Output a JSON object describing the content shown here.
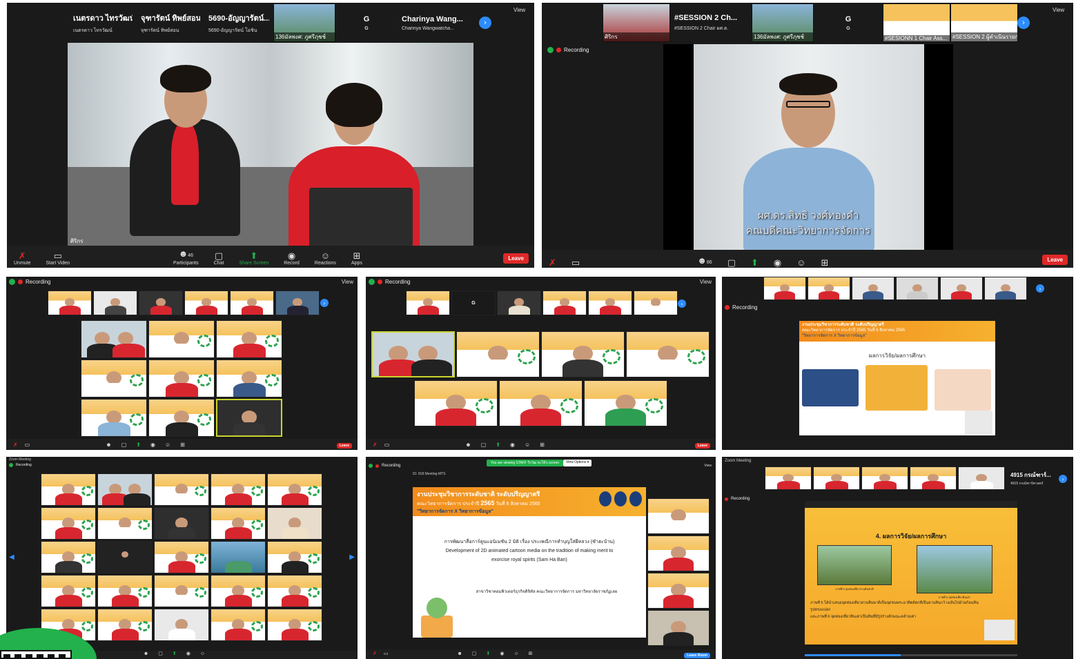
{
  "zoom": {
    "view_label": "View",
    "leave_label": "Leave",
    "recording_label": "Recording",
    "toolbar": {
      "unmute": "Unmute",
      "start_video": "Start Video",
      "participants": "Participants",
      "chat": "Chat",
      "share_screen": "Share Screen",
      "record": "Record",
      "reactions": "Reactions",
      "apps": "Apps"
    },
    "zoom_meeting_title": "Zoom Meeting",
    "leave_room": "Leave Room",
    "view_options": "View Options"
  },
  "panel1": {
    "tiles": [
      {
        "big": "เนตรดาว ไทรวัฒน์",
        "small": "เนตรดาว ไทรวัฒน์"
      },
      {
        "big": "จุฑารัตน์ ทิพย์สอน",
        "small": "จุฑารัตน์ ทิพย์สอน"
      },
      {
        "big": "5690-อัญญารัตน์...",
        "small": "5690-อัญญารัตน์ โอชิน"
      },
      {
        "big": "",
        "small": "136มัลพงศ: ภูศรีภุชช์"
      },
      {
        "big": "G",
        "small": "G"
      },
      {
        "big": "Charinya Wang...",
        "small": "Charinya Wangwatcha..."
      }
    ],
    "participants_count": "46",
    "speaker_label": "ศิริกร"
  },
  "panel2": {
    "tiles": [
      {
        "label": "ศิริกร"
      },
      {
        "big": "#SESSION 2 Ch...",
        "small": "#SESSION 2 Chair ผศ.ด."
      },
      {
        "label": "136มัลพงศ: ภูศรีภุชช์"
      },
      {
        "big": "G",
        "small": "G"
      },
      {
        "label": "#SESIONN 1 Chair Ass..."
      },
      {
        "label": "#SESSION 2 ผู้ดำเนินรายการ"
      }
    ],
    "participants_count": "86",
    "caption_line1": "ผศ.ดร.สิทธิ วงศ์ทองคำ",
    "caption_line2": "คณบดีคณะวิทยาการจัดการ"
  },
  "panel6": {
    "banner_title": "งานประชุมวิชาการระดับชาติ ระดับปริญญาตรี",
    "banner_sub": "คณะวิทยาการจัดการ ประจำปี 2565 วันที่ 6 สิงหาคม 2565",
    "banner_tag": "\"วิทยาการจัดการ X วิทยาการข้อมูล\"",
    "result_title": "ผลการวิจัย/ผลการศึกษา"
  },
  "panel8": {
    "top_notice": "You are viewing STAFF วีรวัฒ ทะให้'s screen",
    "meeting_id": "ID: 918 Meeting-MTS",
    "banner_title": "งานประชุมวิชาการระดับชาติ ระดับปริญญาตรี",
    "banner_sub_a": "คณะวิทยาการจัดการ ประจำปี",
    "banner_year": "2565",
    "banner_sub_b": "วันที่ 6 สิงหาคม 2565",
    "banner_tag": "\"วิทยาการจัดการ X วิทยาการข้อมูล\"",
    "paper_title_th": "การพัฒนาสื่อการ์ตูนแอนิเมชัน 2 มิติ เรื่อง ประเพณีการทำบุญใส่ผีหลวง (ซำฮะบ้าน)",
    "paper_title_en_1": "Development of 2D animated cartoon media on the tradition of making merit to",
    "paper_title_en_2": "exorcise royal spirits (Sam Ha Ban)",
    "department": "สาขาวิชาคอมพิวเตอร์ธุรกิจดิจิทัล คณะวิทยาการจัดการ มหาวิทยาลัยราชภัฏเลย"
  },
  "panel9": {
    "tile_big": "4915 กรณ์ฑาร์...",
    "tile_small": "4915 กรณ์ฑาร์ศาสตร์",
    "slide_heading": "4. ผลการวิจัย/ผลการศึกษา",
    "line1": "ภาพที่ 5 ได้นำเสนอจุดท่องเที่ยวสวนหินพาดิเป็นจุดขนพระอาทิตย์ตกที่เป็นลานหินกว้างเส้นไปด้วยก้อนหิน",
    "line2": "รูปทรงแปลก",
    "line3": "และภาพที่ 6 จุดท่องเที่ยวหินเต่าเป็นหินที่มีรูปร่างลักษณะคล้ายเต่า",
    "img_cap1": "ภาพที่ 5 จุดท่องเที่ยวสวนหินพาดิ",
    "img_cap2": "ภาพที่ 6 จุดท่องเที่ยวหินเต่า"
  },
  "colors": {
    "zoom_blue": "#2d8cff",
    "leave_red": "#e02828",
    "share_green": "#22b14c",
    "banner_orange": "#f28c1b"
  }
}
